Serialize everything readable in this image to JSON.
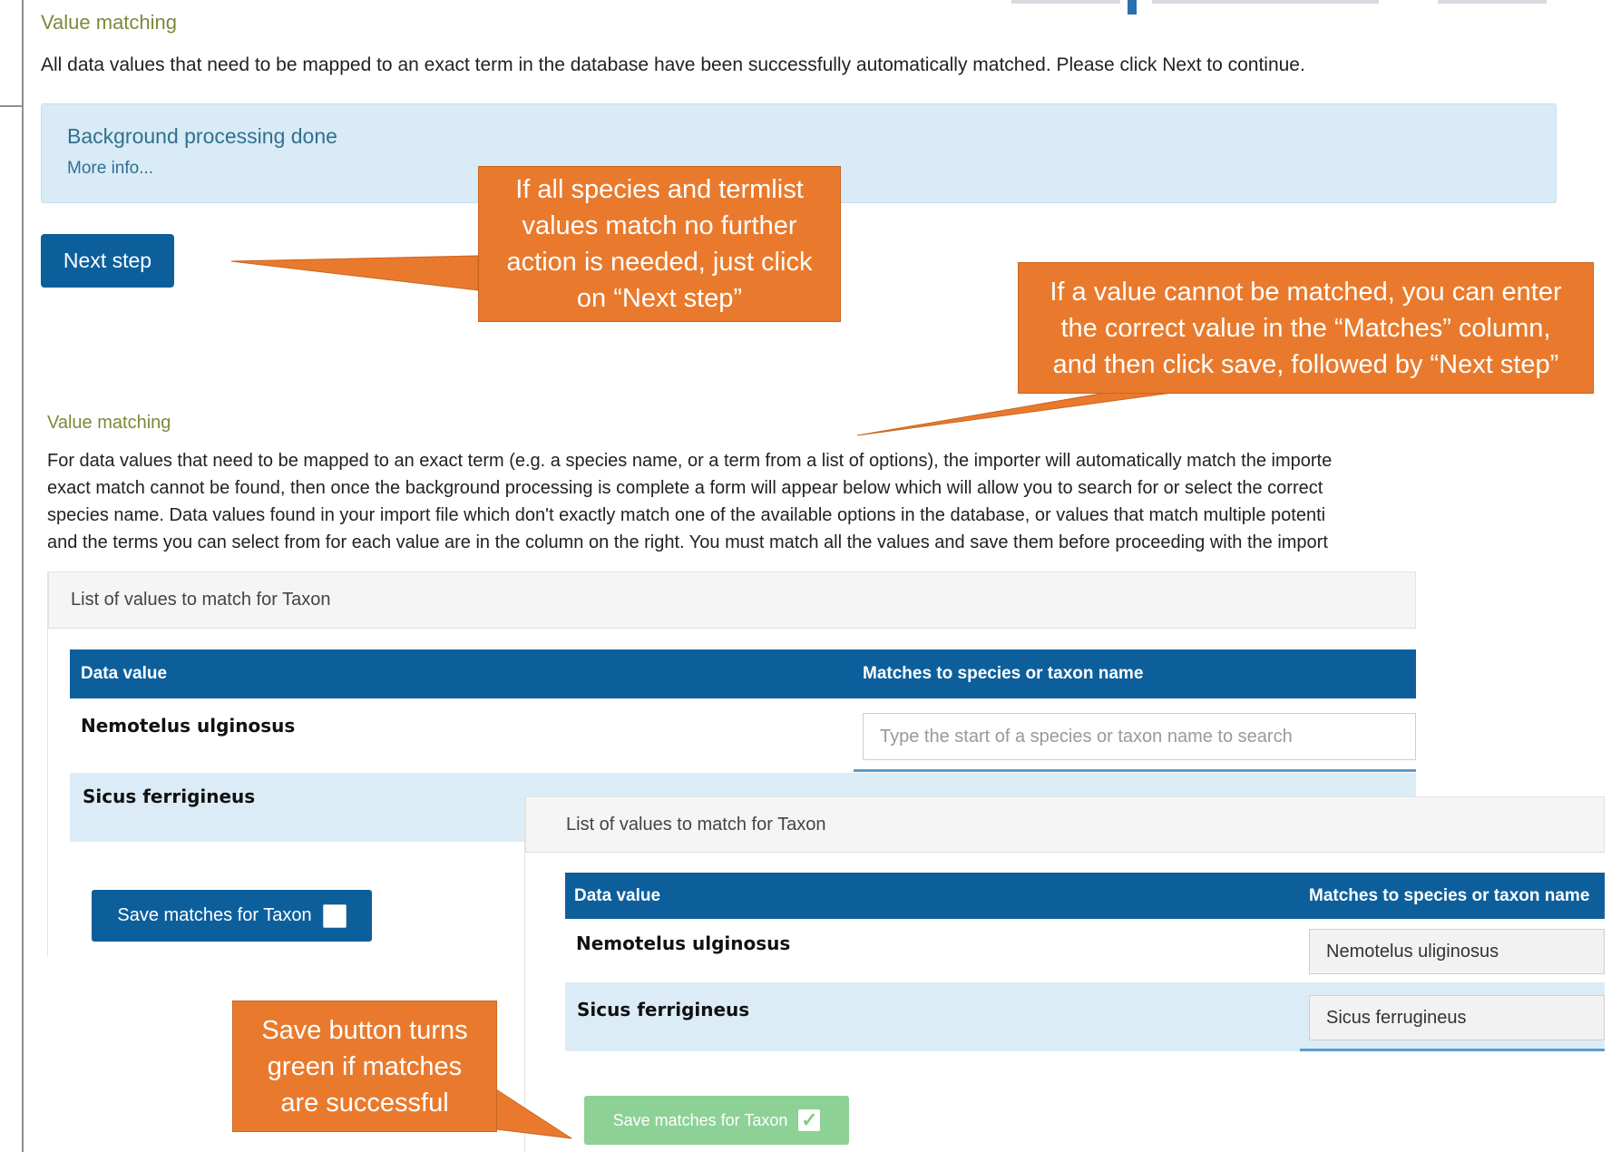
{
  "top": {
    "section_title": "Value matching",
    "intro": "All data values that need to be mapped to an exact term in the database have been successfully automatically matched. Please click Next to continue."
  },
  "info_box": {
    "title": "Background processing done",
    "link": "More info..."
  },
  "next_button": "Next step",
  "callouts": {
    "next_step": [
      "If all species and termlist",
      "values match no further",
      "action is needed, just click",
      "on “Next step”"
    ],
    "cannot_match": [
      "If a value cannot be matched, you can enter",
      "the correct value in the “Matches” column,",
      "and then click save, followed by “Next step”"
    ],
    "save_green": [
      "Save button turns",
      "green if matches",
      "are successful"
    ]
  },
  "second": {
    "section_title": "Value matching",
    "paragraph": [
      "For data values that need to be mapped to an exact term (e.g. a species name, or a term from a list of options), the importer will automatically match the importe",
      "exact match cannot be found, then once the background processing is complete a form will appear below which will allow you to search for or select the correct",
      "species name. Data values found in your import file which don't exactly match one of the available options in the database, or values that match multiple potenti",
      "and the terms you can select from for each value are in the column on the right. You must match all the values and save them before proceeding with the import"
    ]
  },
  "panel_before": {
    "heading": "List of values to match for Taxon",
    "col_data": "Data value",
    "col_match": "Matches to species or taxon name",
    "rows": [
      {
        "label": "Nemotelus ulginosus",
        "placeholder": "Type the start of a species or taxon name to search"
      },
      {
        "label": "Sicus ferrigineus"
      }
    ],
    "save_label": "Save matches for Taxon"
  },
  "panel_after": {
    "heading": "List of values to match for Taxon",
    "col_data": "Data value",
    "col_match": "Matches to species or taxon name",
    "rows": [
      {
        "label": "Nemotelus ulginosus",
        "value": "Nemotelus uliginosus"
      },
      {
        "label": "Sicus ferrigineus",
        "value": "Sicus ferrugineus"
      }
    ],
    "save_label": "Save matches for Taxon",
    "check_glyph": "✓"
  },
  "colors": {
    "primary": "#0d5f9c",
    "callout": "#e97a2d",
    "info_bg": "#d8ebf6",
    "success": "#7ccf86",
    "row_shade": "#dcecf7"
  }
}
